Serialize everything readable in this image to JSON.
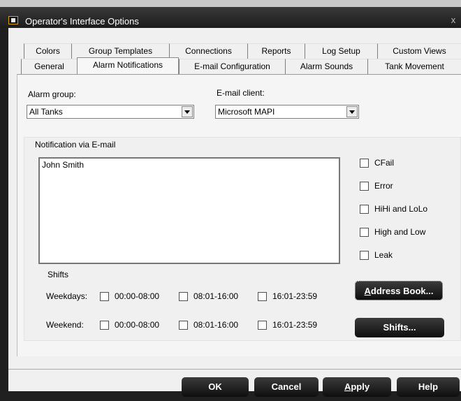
{
  "window": {
    "title": "Operator's Interface Options",
    "close_glyph": "x"
  },
  "tabs_row1": [
    "Colors",
    "Group Templates",
    "Connections",
    "Reports",
    "Log Setup",
    "Custom Views"
  ],
  "tabs_row2": [
    "General",
    "Alarm Notifications",
    "E-mail Configuration",
    "Alarm Sounds",
    "Tank Movement"
  ],
  "active_tab": "Alarm Notifications",
  "alarm_group": {
    "label": "Alarm group:",
    "value": "All Tanks"
  },
  "email_client": {
    "label": "E-mail client:",
    "value": "Microsoft MAPI"
  },
  "notification": {
    "group_label": "Notification via E-mail",
    "recipients": [
      "John Smith"
    ],
    "alarm_types": [
      {
        "label": "CFail",
        "checked": false
      },
      {
        "label": "Error",
        "checked": false
      },
      {
        "label": "HiHi and LoLo",
        "checked": false
      },
      {
        "label": "High and Low",
        "checked": false
      },
      {
        "label": "Leak",
        "checked": false
      }
    ]
  },
  "shifts": {
    "title": "Shifts",
    "weekdays_label": "Weekdays:",
    "weekend_label": "Weekend:",
    "ranges": [
      "00:00-08:00",
      "08:01-16:00",
      "16:01-23:59"
    ]
  },
  "buttons": {
    "address_book_prefix": "A",
    "address_book_rest": "ddress Book...",
    "shifts": "Shifts...",
    "ok": "OK",
    "cancel": "Cancel",
    "apply_prefix": "A",
    "apply_rest": "pply",
    "help": "Help"
  }
}
